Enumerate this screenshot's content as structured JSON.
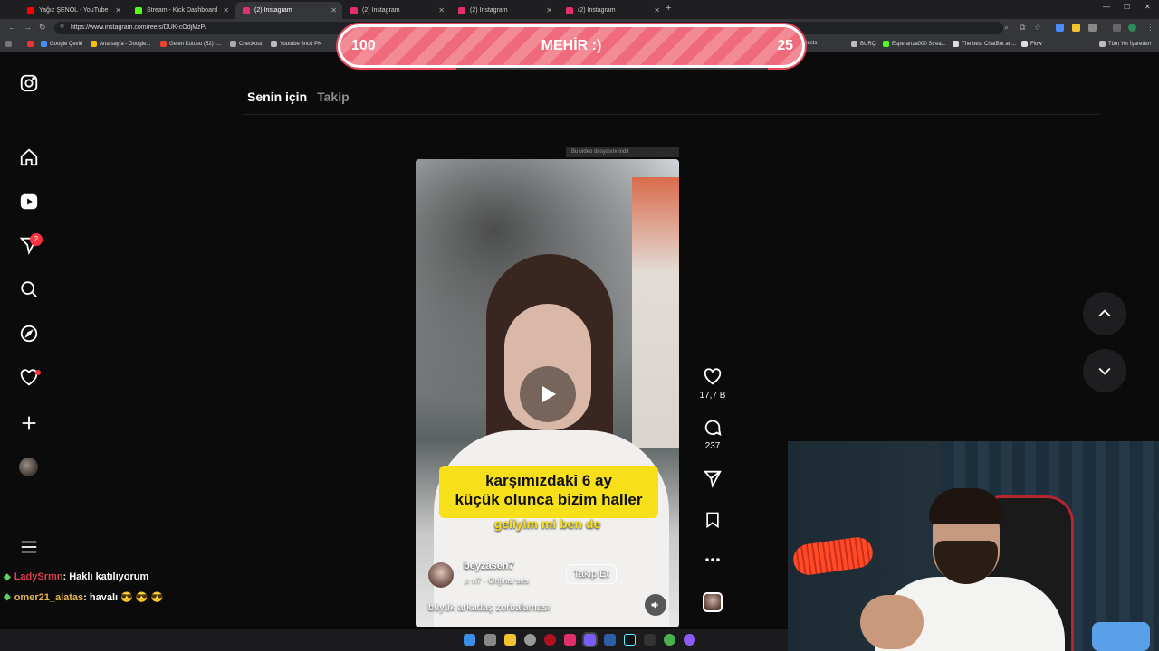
{
  "browser": {
    "tabs": [
      {
        "title": "Yağız ŞENOL - YouTube",
        "favicon_color": "#ff0000"
      },
      {
        "title": "Stream - Kick Dashboard",
        "favicon_color": "#53fc18"
      },
      {
        "title": "(2) Instagram",
        "favicon_color": "#e1306c"
      },
      {
        "title": "(2) Instagram",
        "favicon_color": "#e1306c"
      },
      {
        "title": "(2) Instagram",
        "favicon_color": "#e1306c"
      },
      {
        "title": "(2) Instagram",
        "favicon_color": "#e1306c"
      }
    ],
    "url": "https://www.instagram.com/reels/DUK-cOdjMzP/",
    "bookmarks": [
      "Google Çeviri",
      "Ana sayfa - Google...",
      "Gelen Kutusu (52) -...",
      "Checkout",
      "Youtube 3ncü PK",
      "Gen - Projects",
      "BURÇ",
      "Esperanza000 Strea...",
      "The best ChatBot an...",
      "Flow",
      "Tüm Yer İşaretleri"
    ]
  },
  "overlay": {
    "left_value": "100",
    "center_label": "MEHİR :)",
    "right_value": "25"
  },
  "sidebar": {
    "notifications_badge": "2"
  },
  "feed": {
    "tab_for_you": "Senin için",
    "tab_following": "Takip",
    "download_strip": "Bu video dosyasını indir"
  },
  "reel": {
    "caption_line1": "karşımızdaki 6 ay",
    "caption_line2": "küçük olunca bizim haller",
    "caption_sub": "geliyim mi ben de",
    "author": "beyzasen7",
    "audio": "n7 · Orijinal ses",
    "follow_label": "Takip Et",
    "description": "büyük arkadaş zorbalaması",
    "likes": "17,7 B",
    "comments": "237"
  },
  "chat": [
    {
      "user": "LadySrmn",
      "message": ": Haklı katılıyorum"
    },
    {
      "user": "omer21_alatas",
      "message": ": havalı 😎 😎 😎"
    }
  ]
}
